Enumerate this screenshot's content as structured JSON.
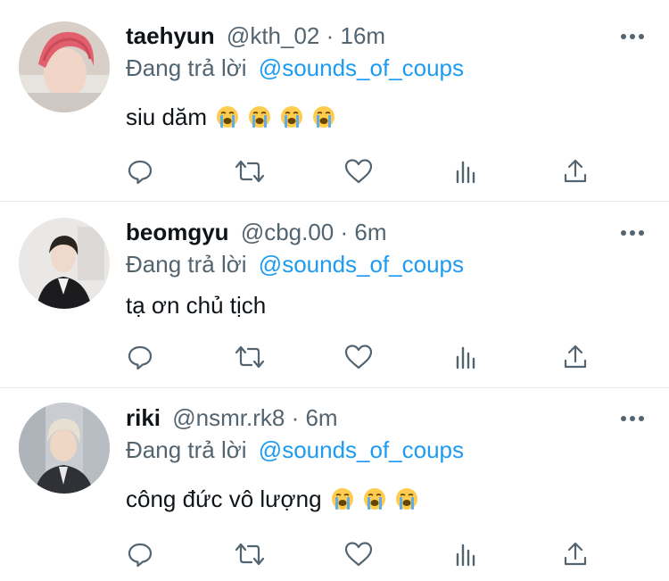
{
  "reply_prefix": "Đang trả lời",
  "tweets": [
    {
      "display_name": "taehyun",
      "handle_time": "@kth_02 · 16m",
      "replying_to": "@sounds_of_coups",
      "text": "siu dăm",
      "emoji_count": 4,
      "emoji_icon": "loudly-crying-face-icon"
    },
    {
      "display_name": "beomgyu",
      "handle_time": "@cbg.00 · 6m",
      "replying_to": "@sounds_of_coups",
      "text": "tạ ơn chủ tịch",
      "emoji_count": 0,
      "emoji_icon": ""
    },
    {
      "display_name": "riki",
      "handle_time": "@nsmr.rk8 · 6m",
      "replying_to": "@sounds_of_coups",
      "text": "công đức vô lượng",
      "emoji_count": 3,
      "emoji_icon": "loudly-crying-face-icon"
    }
  ],
  "action_icons": [
    "reply-icon",
    "retweet-icon",
    "like-icon",
    "analytics-icon",
    "share-icon"
  ],
  "colors": {
    "text": "#0f1419",
    "secondary": "#536471",
    "link": "#1d9bf0",
    "divider": "#e6e9eb"
  }
}
